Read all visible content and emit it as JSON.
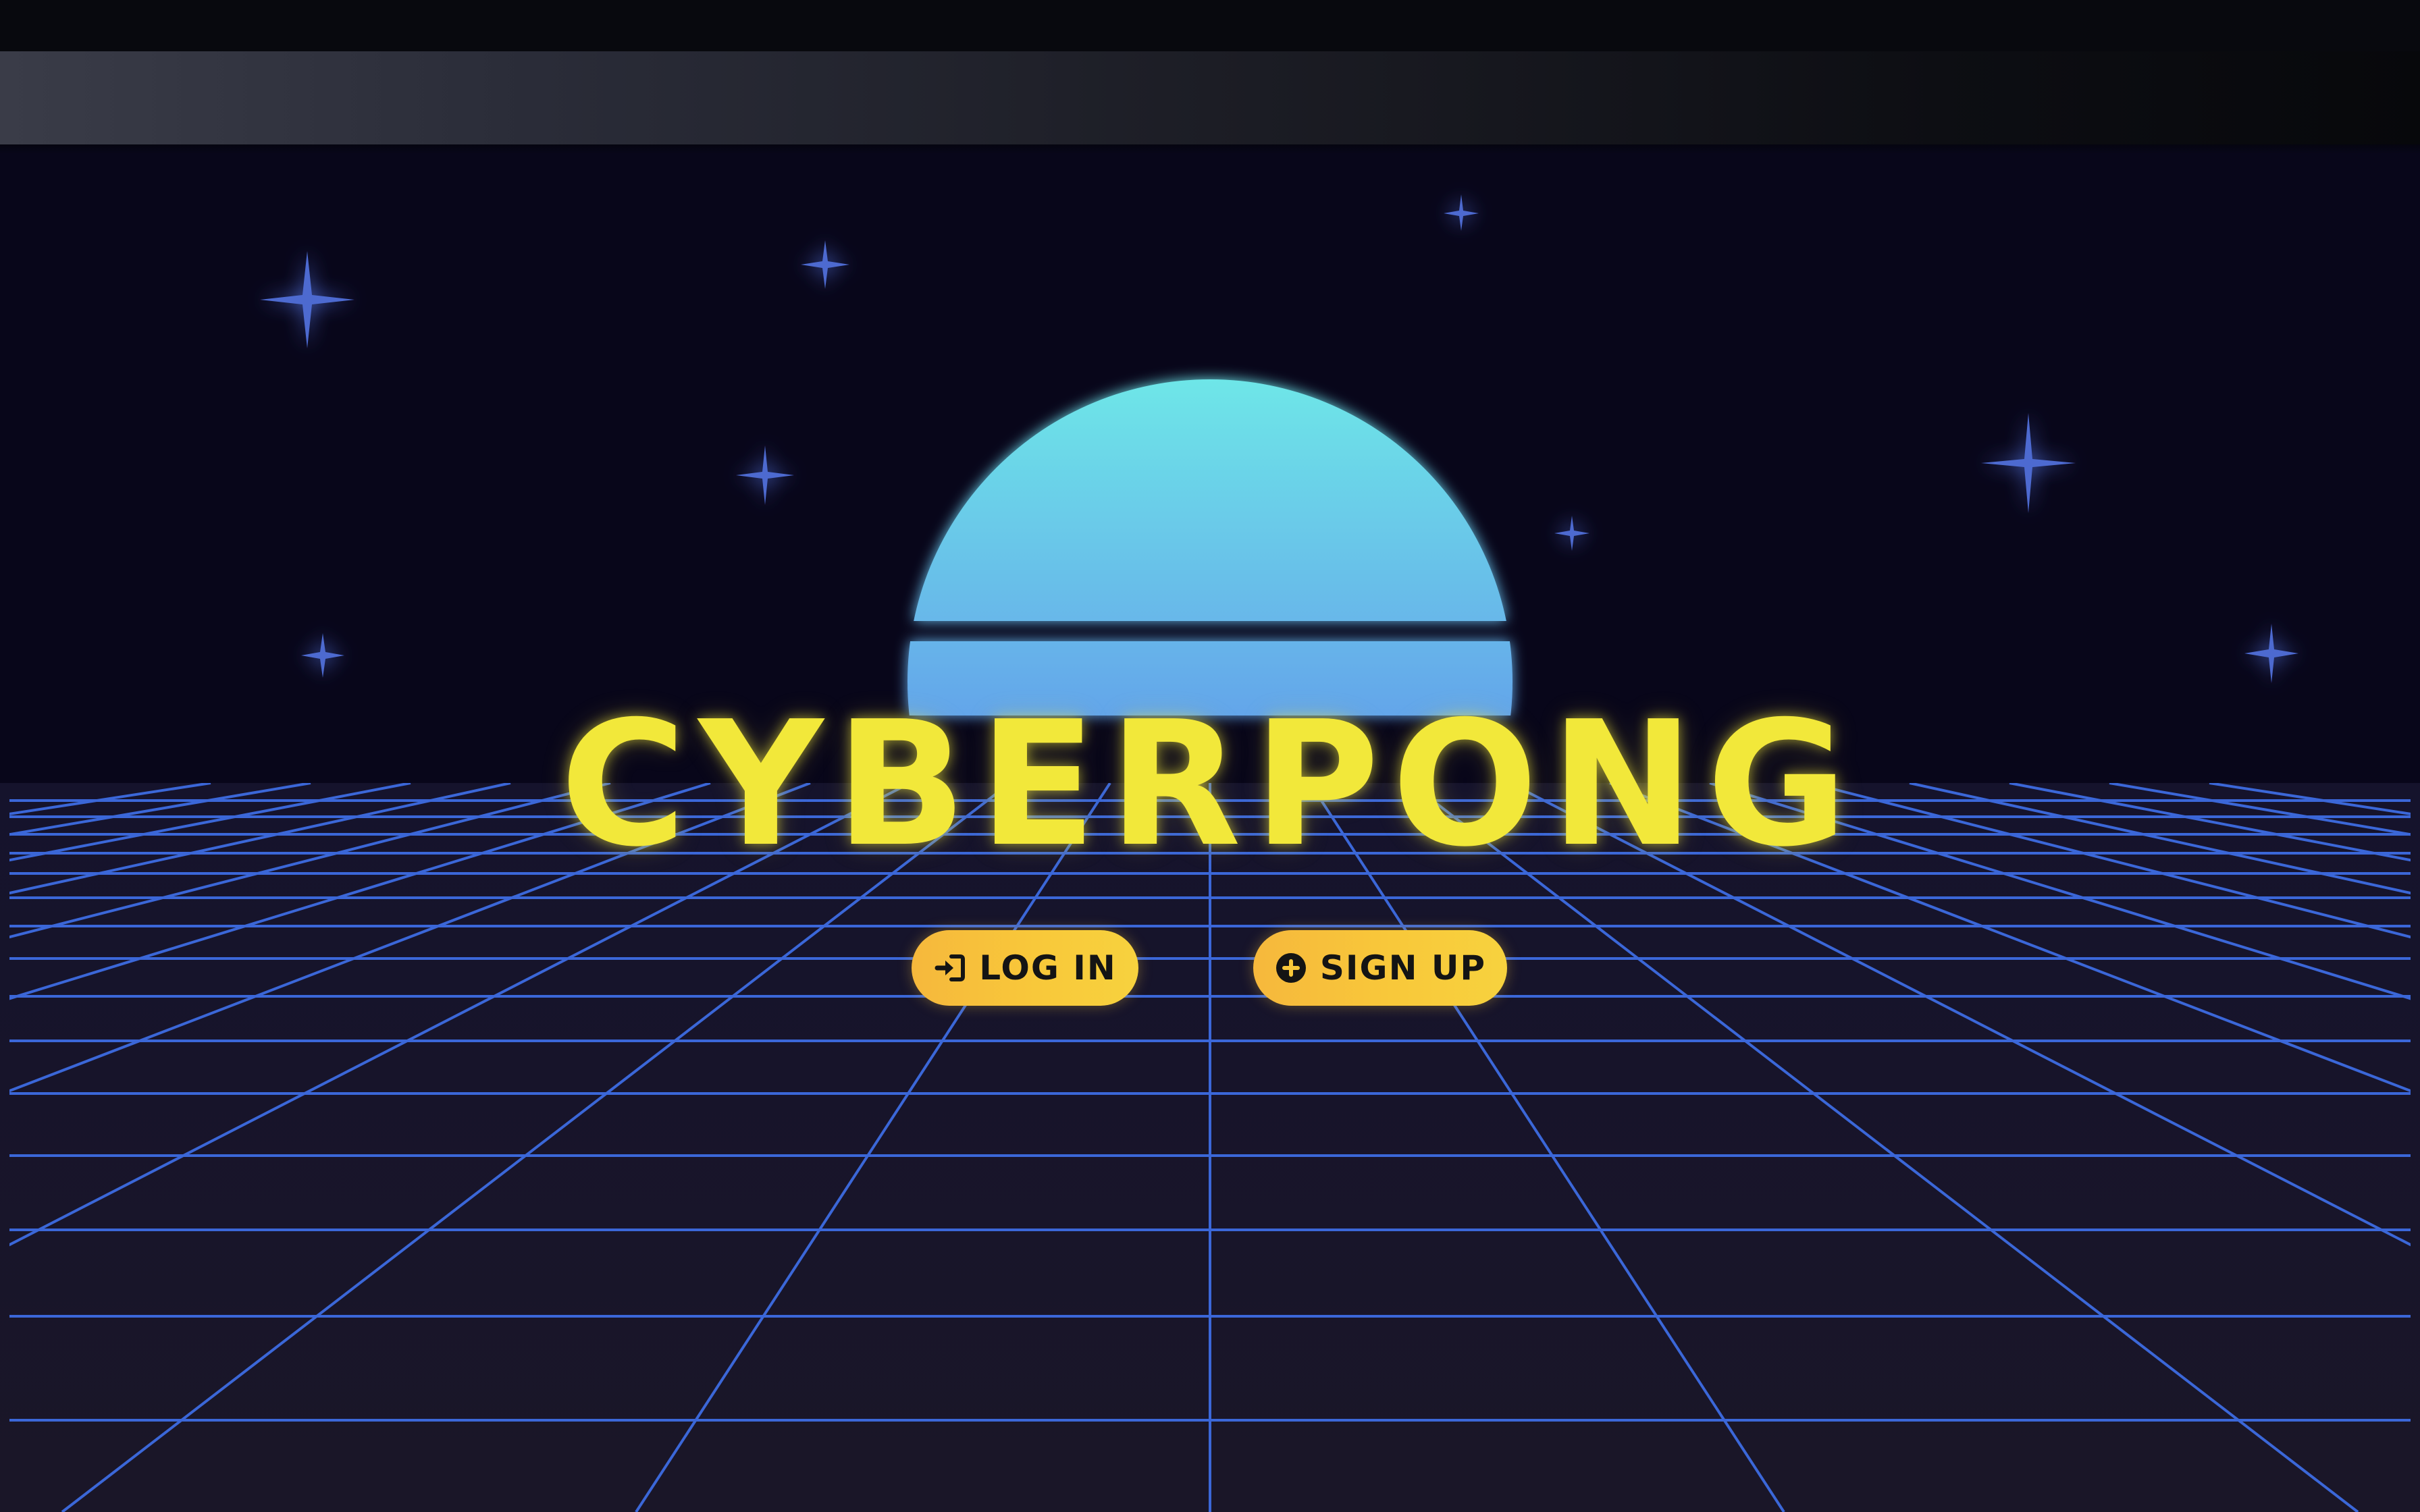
{
  "app": {
    "title": "CYBERPONG"
  },
  "actions": {
    "login_label": "LOG IN",
    "signup_label": "SIGN UP"
  },
  "icons": {
    "login": "sign-in-icon",
    "signup": "plus-circle-icon"
  },
  "colors": {
    "background": "#08061a",
    "grid": "#3b67d8",
    "title": "#f2e83a",
    "button": "#f8c83a",
    "sun_top": "#6ee3e8",
    "sun_bottom": "#6b6fe0",
    "star": "#4d6bd0"
  }
}
